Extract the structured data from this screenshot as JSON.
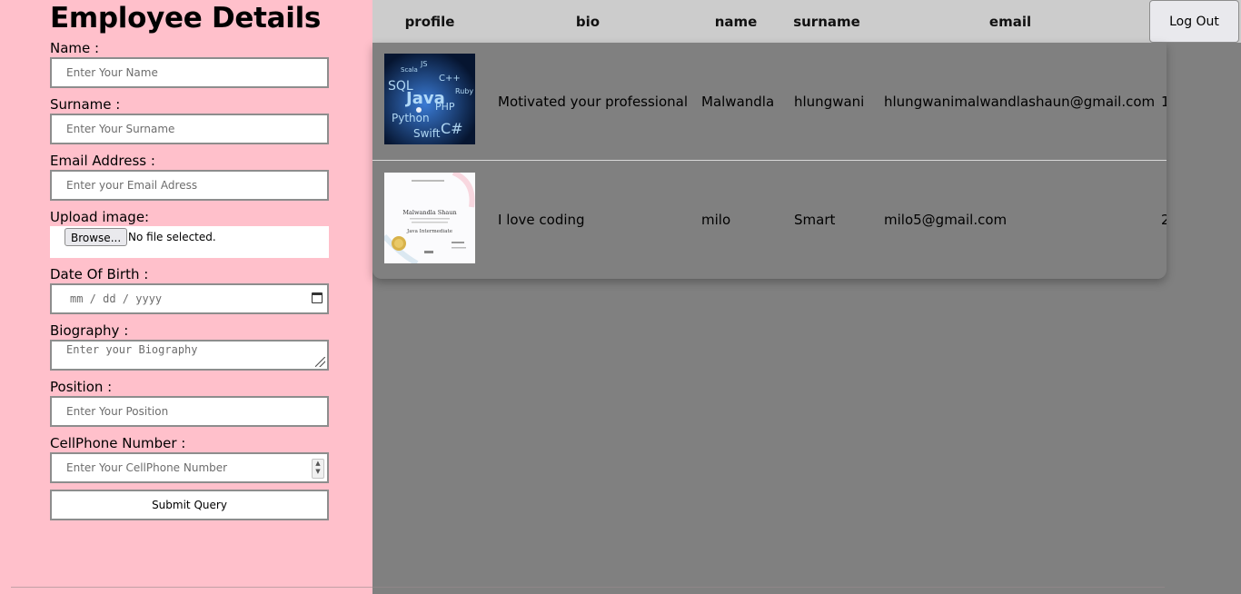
{
  "form": {
    "title": "Employee Details",
    "name_label": "Name :",
    "name_placeholder": "Enter Your Name",
    "surname_label": "Surname :",
    "surname_placeholder": "Enter Your Surname",
    "email_label": "Email Address :",
    "email_placeholder": "Enter your Email Adress",
    "upload_label": "Upload image:",
    "browse_label": "Browse...",
    "no_file_text": "No file selected.",
    "dob_label": "Date Of Birth :",
    "dob_placeholder": "mm / dd / yyyy",
    "bio_label": "Biography :",
    "bio_placeholder": "Enter your Biography",
    "position_label": "Position :",
    "position_placeholder": "Enter Your Position",
    "cell_label": "CellPhone Number :",
    "cell_placeholder": "Enter Your CellPhone Number",
    "submit_label": "Submit Query"
  },
  "header": {
    "columns": [
      "profile",
      "bio",
      "name",
      "surname",
      "email"
    ],
    "logout_label": "Log Out"
  },
  "rows": [
    {
      "bio": "Motivated your professional",
      "name": "Malwandla",
      "surname": "hlungwani",
      "email": "hlungwanimalwandlashaun@gmail.com",
      "overflow": "1",
      "thumb_words": [
        "SQL",
        "Java",
        "Python",
        "PHP",
        "C#",
        "Swift",
        "C++",
        "Scala",
        "Ruby",
        "JS"
      ]
    },
    {
      "bio": "I love coding",
      "name": "milo",
      "surname": "Smart",
      "email": "milo5@gmail.com",
      "overflow": "2",
      "thumb_words": [
        "Malwandla Shaun",
        "Java Intermediate"
      ]
    }
  ],
  "colors": {
    "sidebar": "#ffc0cb",
    "page": "#808080",
    "header": "#cccccc"
  }
}
